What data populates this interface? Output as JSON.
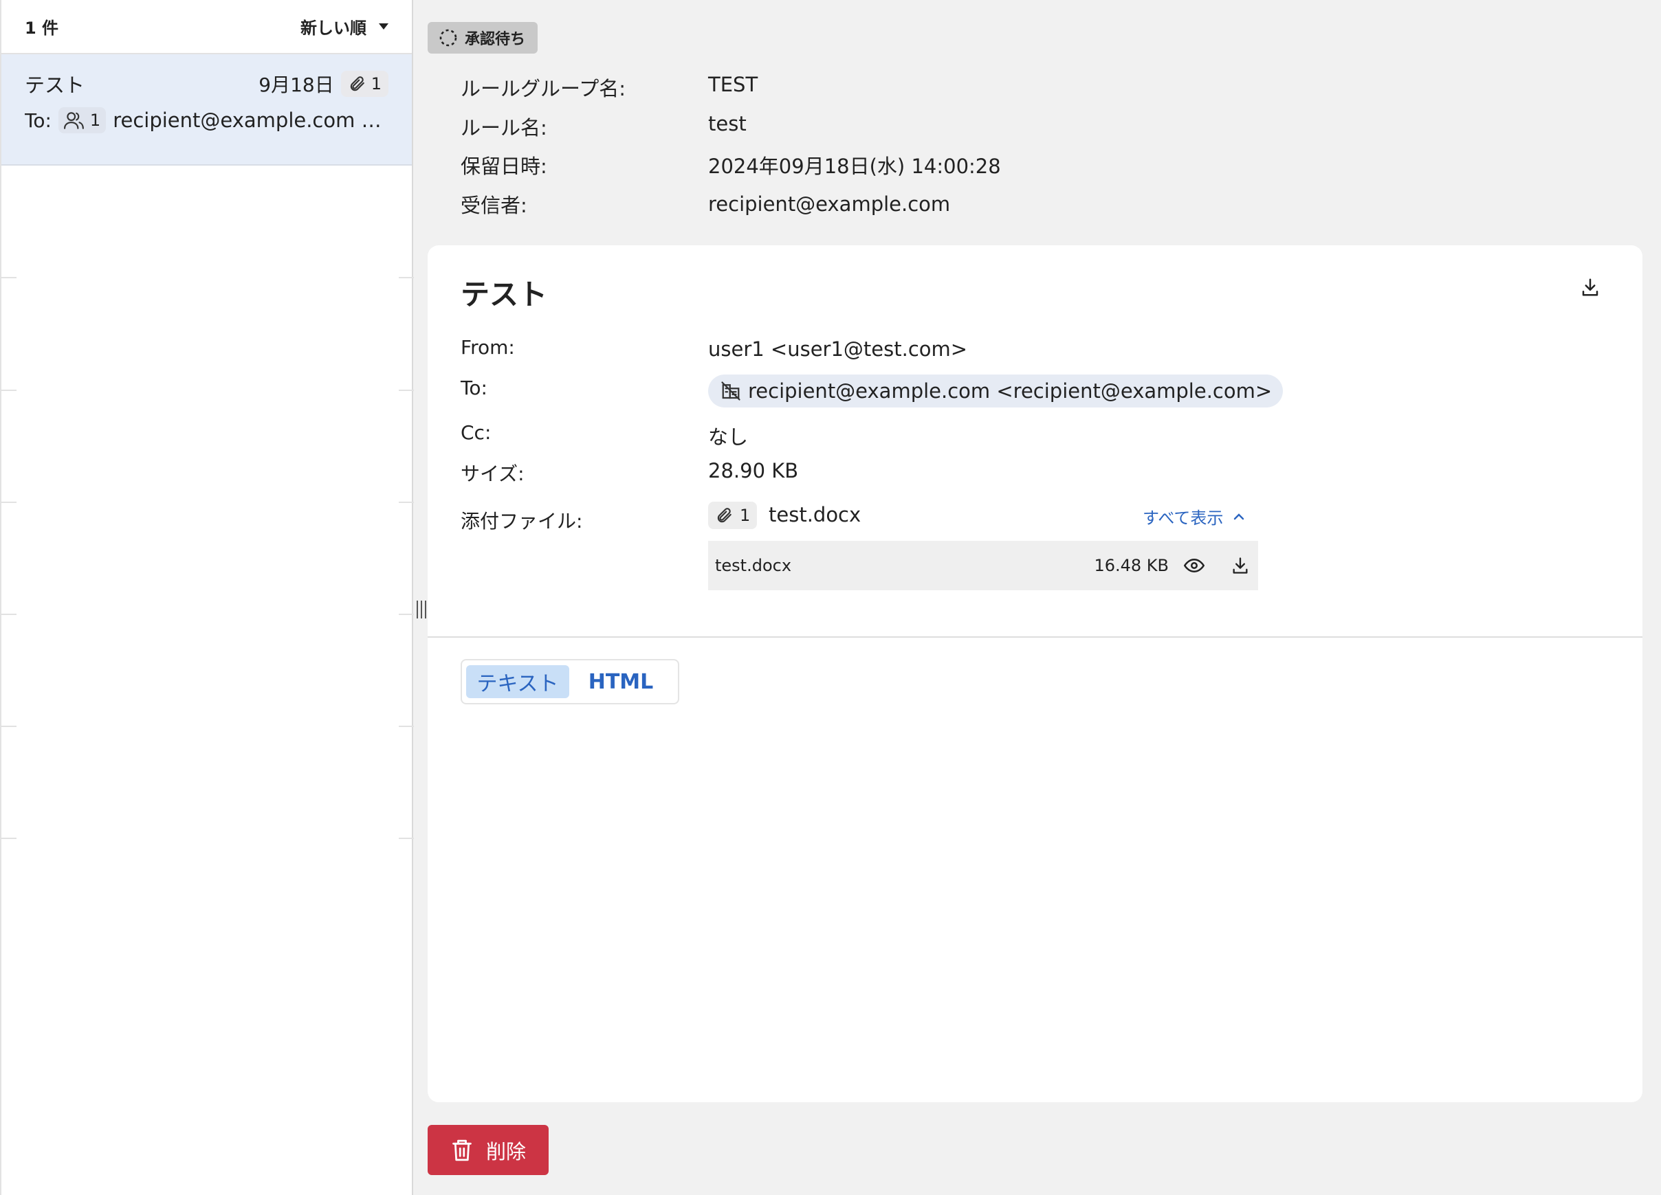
{
  "list": {
    "count": "1 件",
    "sort_label": "新しい順",
    "items": [
      {
        "subject": "テスト",
        "date": "9月18日",
        "attachments": "1",
        "to_label": "To:",
        "recipient_count": "1",
        "recipient": "recipient@example.com <recipient@example.com>"
      }
    ]
  },
  "detail": {
    "status": "承認待ち",
    "meta": [
      {
        "label": "ルールグループ名:",
        "value": "TEST"
      },
      {
        "label": "ルール名:",
        "value": "test"
      },
      {
        "label": "保留日時:",
        "value": "2024年09月18日(水) 14:00:28"
      },
      {
        "label": "受信者:",
        "value": "recipient@example.com"
      }
    ],
    "subject": "テスト",
    "from_label": "From:",
    "from_value": "user1 <user1@test.com>",
    "to_label": "To:",
    "to_value": "recipient@example.com <recipient@example.com>",
    "cc_label": "Cc:",
    "cc_value": "なし",
    "size_label": "サイズ:",
    "size_value": "28.90 KB",
    "attach_label": "添付ファイル:",
    "attach_count": "1",
    "attach_name": "test.docx",
    "show_all": "すべて表示",
    "files": [
      {
        "name": "test.docx",
        "size": "16.48 KB"
      }
    ],
    "tabs": [
      "テキスト",
      "HTML"
    ],
    "delete_label": "削除"
  },
  "colors": {
    "accent": "#2a64c0",
    "danger": "#cc3444",
    "selected_row": "#e6edf8",
    "status_badge": "#c9c9c9"
  }
}
